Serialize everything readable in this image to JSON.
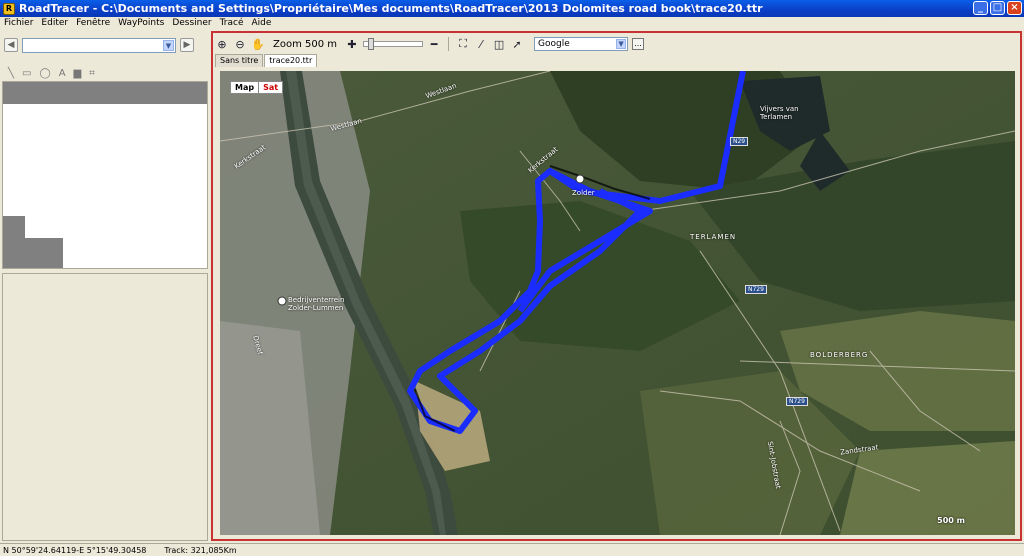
{
  "window": {
    "title": "RoadTracer - C:\\Documents and Settings\\Propriétaire\\Mes documents\\RoadTracer\\2013 Dolomites road book\\trace20.ttr",
    "min": "_",
    "max": "□",
    "close": "×"
  },
  "menu": [
    "Fichier",
    "Editer",
    "Fenêtre",
    "WayPoints",
    "Dessiner",
    "Tracé",
    "Aide"
  ],
  "toolbar": {
    "zoom_label": "Zoom 500 m",
    "source_value": "Google",
    "more_label": "..."
  },
  "tabs": [
    "Sans titre",
    "trace20.ttr"
  ],
  "map": {
    "btn_map": "Map",
    "btn_sat": "Sat",
    "labels": {
      "westlaan": "Westlaan",
      "westlaan2": "Westlaan",
      "kerkstraat": "Kerkstraat",
      "kerkstraat2": "Kerkstraat",
      "zolder": "Zolder",
      "terlamen": "TERLAMEN",
      "bolderberg": "BOLDERBERG",
      "vijvers": "Vijvers van Terlamen",
      "bedrijventerrein": "Bedrijventerrein Zolder-Lummen",
      "zandstraat": "Zandstraat",
      "dreef": "Dreef",
      "sint": "Sint-Jobstraat"
    },
    "roads": {
      "n29a": "N29",
      "n729": "N729",
      "n29b": "N729"
    },
    "scale": "500 m"
  },
  "status": {
    "coords": "N 50°59'24.64119-E 5°15'49.30458",
    "track": "Track: 321,085Km"
  },
  "colors": {
    "frame": "#c83232",
    "track": "#1a2cff"
  }
}
